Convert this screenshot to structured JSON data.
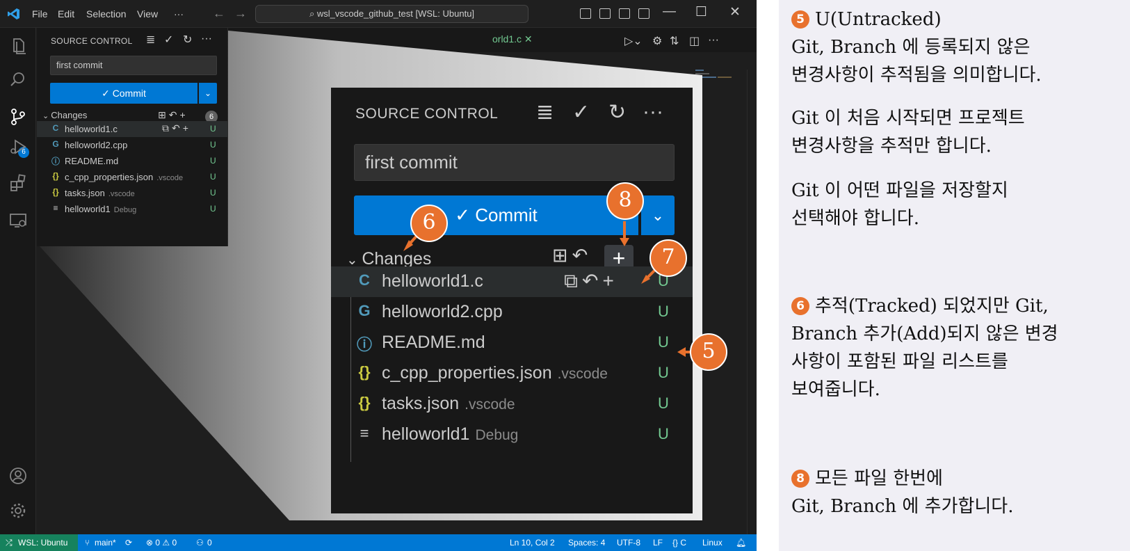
{
  "titlebar": {
    "menus": [
      "File",
      "Edit",
      "Selection",
      "View",
      "···"
    ],
    "command_center": "wsl_vscode_github_test [WSL: Ubuntu]",
    "window_controls": [
      "—",
      "☐",
      "✕"
    ]
  },
  "activity_bar": {
    "items": [
      "explorer-icon",
      "search-icon",
      "source-control-icon",
      "run-debug-icon",
      "extensions-icon",
      "remote-explorer-icon",
      "account-icon",
      "manage-gear-icon"
    ],
    "scm_badge": "6"
  },
  "sidebar": {
    "title": "SOURCE CONTROL",
    "commit_message": "first commit",
    "commit_button": "✓ Commit",
    "changes_label": "Changes",
    "changes_count": "6",
    "files": [
      {
        "name": "helloworld1.c",
        "dir": "",
        "icon": "C",
        "icon_color": "#519aba",
        "status": "U"
      },
      {
        "name": "helloworld2.cpp",
        "dir": "",
        "icon": "G",
        "icon_color": "#519aba",
        "status": "U"
      },
      {
        "name": "README.md",
        "dir": "",
        "icon": "ⓘ",
        "icon_color": "#519aba",
        "status": "U"
      },
      {
        "name": "c_cpp_properties.json",
        "dir": ".vscode",
        "icon": "{}",
        "icon_color": "#cbcb41",
        "status": "U"
      },
      {
        "name": "tasks.json",
        "dir": ".vscode",
        "icon": "{}",
        "icon_color": "#cbcb41",
        "status": "U"
      },
      {
        "name": "helloworld1",
        "dir": "Debug",
        "icon": "≡",
        "icon_color": "#cccccc",
        "status": "U"
      }
    ]
  },
  "editor": {
    "tab_partial": "orld1.c ✕"
  },
  "statusbar": {
    "remote": "WSL: Ubuntu",
    "branch": "main*",
    "problems": "⊗ 0 ⚠ 0",
    "ports": "0",
    "position": "Ln 10, Col 2",
    "spaces": "Spaces: 4",
    "encoding": "UTF-8",
    "eol": "LF",
    "language": "{} C",
    "platform": "Linux"
  },
  "zoom": {
    "title": "SOURCE CONTROL",
    "commit_message": "first commit",
    "commit_button": "✓ Commit",
    "changes_label": "Changes"
  },
  "callouts": {
    "c5": "5",
    "c6": "6",
    "c7": "7",
    "c8": "8"
  },
  "explanation": {
    "p1_num": "5",
    "p1_lines": [
      "U(Untracked)",
      "Git, Branch 에 등록되지 않은",
      "변경사항이 추적됨을 의미합니다."
    ],
    "p2_lines": [
      "Git 이 처음 시작되면 프로젝트",
      "변경사항을 추적만 합니다."
    ],
    "p3_lines": [
      "Git 이 어떤 파일을 저장할지",
      "선택해야 합니다."
    ],
    "p4_num": "6",
    "p4_lines": [
      "추적(Tracked) 되었지만 Git,",
      "Branch 추가(Add)되지 않은 변경",
      "사항이 포함된 파일 리스트를",
      "보여줍니다."
    ],
    "p5_num": "8",
    "p5_lines": [
      "모든 파일 한번에",
      "Git, Branch 에 추가합니다."
    ]
  },
  "colors": {
    "accent": "#0078d4",
    "untracked": "#73c991",
    "callout": "#e8712d",
    "remote": "#16825d"
  }
}
